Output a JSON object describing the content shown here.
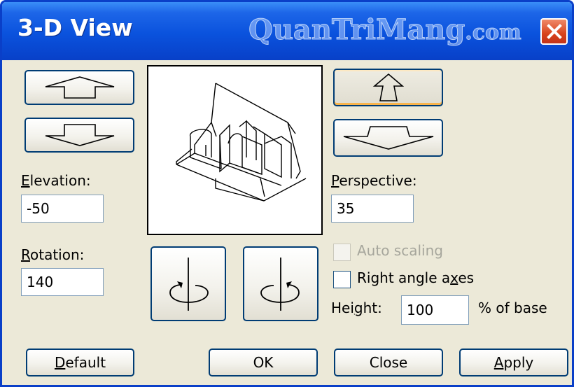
{
  "window": {
    "title": "3-D View",
    "watermark": "QuanTriMang",
    "watermark_suffix": ".com",
    "close_icon": "close-x-icon"
  },
  "elevation": {
    "label_key": "E",
    "label_rest": "levation:",
    "value": "-50",
    "up_button_icon": "arrow-up-icon",
    "down_button_icon": "arrow-down-icon"
  },
  "rotation": {
    "label_key": "R",
    "label_rest": "otation:",
    "value": "140",
    "rotate_left_icon": "rotate-counterclockwise-icon",
    "rotate_right_icon": "rotate-clockwise-icon"
  },
  "perspective": {
    "label_key": "P",
    "label_rest": "erspective:",
    "value": "35",
    "increase_icon": "perspective-narrow-icon",
    "decrease_icon": "perspective-wide-icon"
  },
  "auto_scaling": {
    "label": "Auto scaling",
    "checked": false,
    "enabled": false
  },
  "right_angle_axes": {
    "label_pre": "Right angle a",
    "label_key": "x",
    "label_post": "es",
    "checked": false
  },
  "height": {
    "label_pre": "Hei",
    "label_key": "g",
    "label_post": "ht:",
    "value": "100",
    "suffix": "% of base"
  },
  "preview": {
    "icon": "3d-chart-wireframe-preview"
  },
  "buttons": {
    "default": {
      "key": "D",
      "rest": "efault"
    },
    "ok": "OK",
    "close": "Close",
    "apply": {
      "key": "A",
      "rest": "pply"
    }
  },
  "colors": {
    "titlebar": "#0a52dd",
    "dialog_bg": "#ece9d8",
    "button_border": "#003c74",
    "close_button": "#d8431c",
    "field_border": "#7f9db9"
  }
}
